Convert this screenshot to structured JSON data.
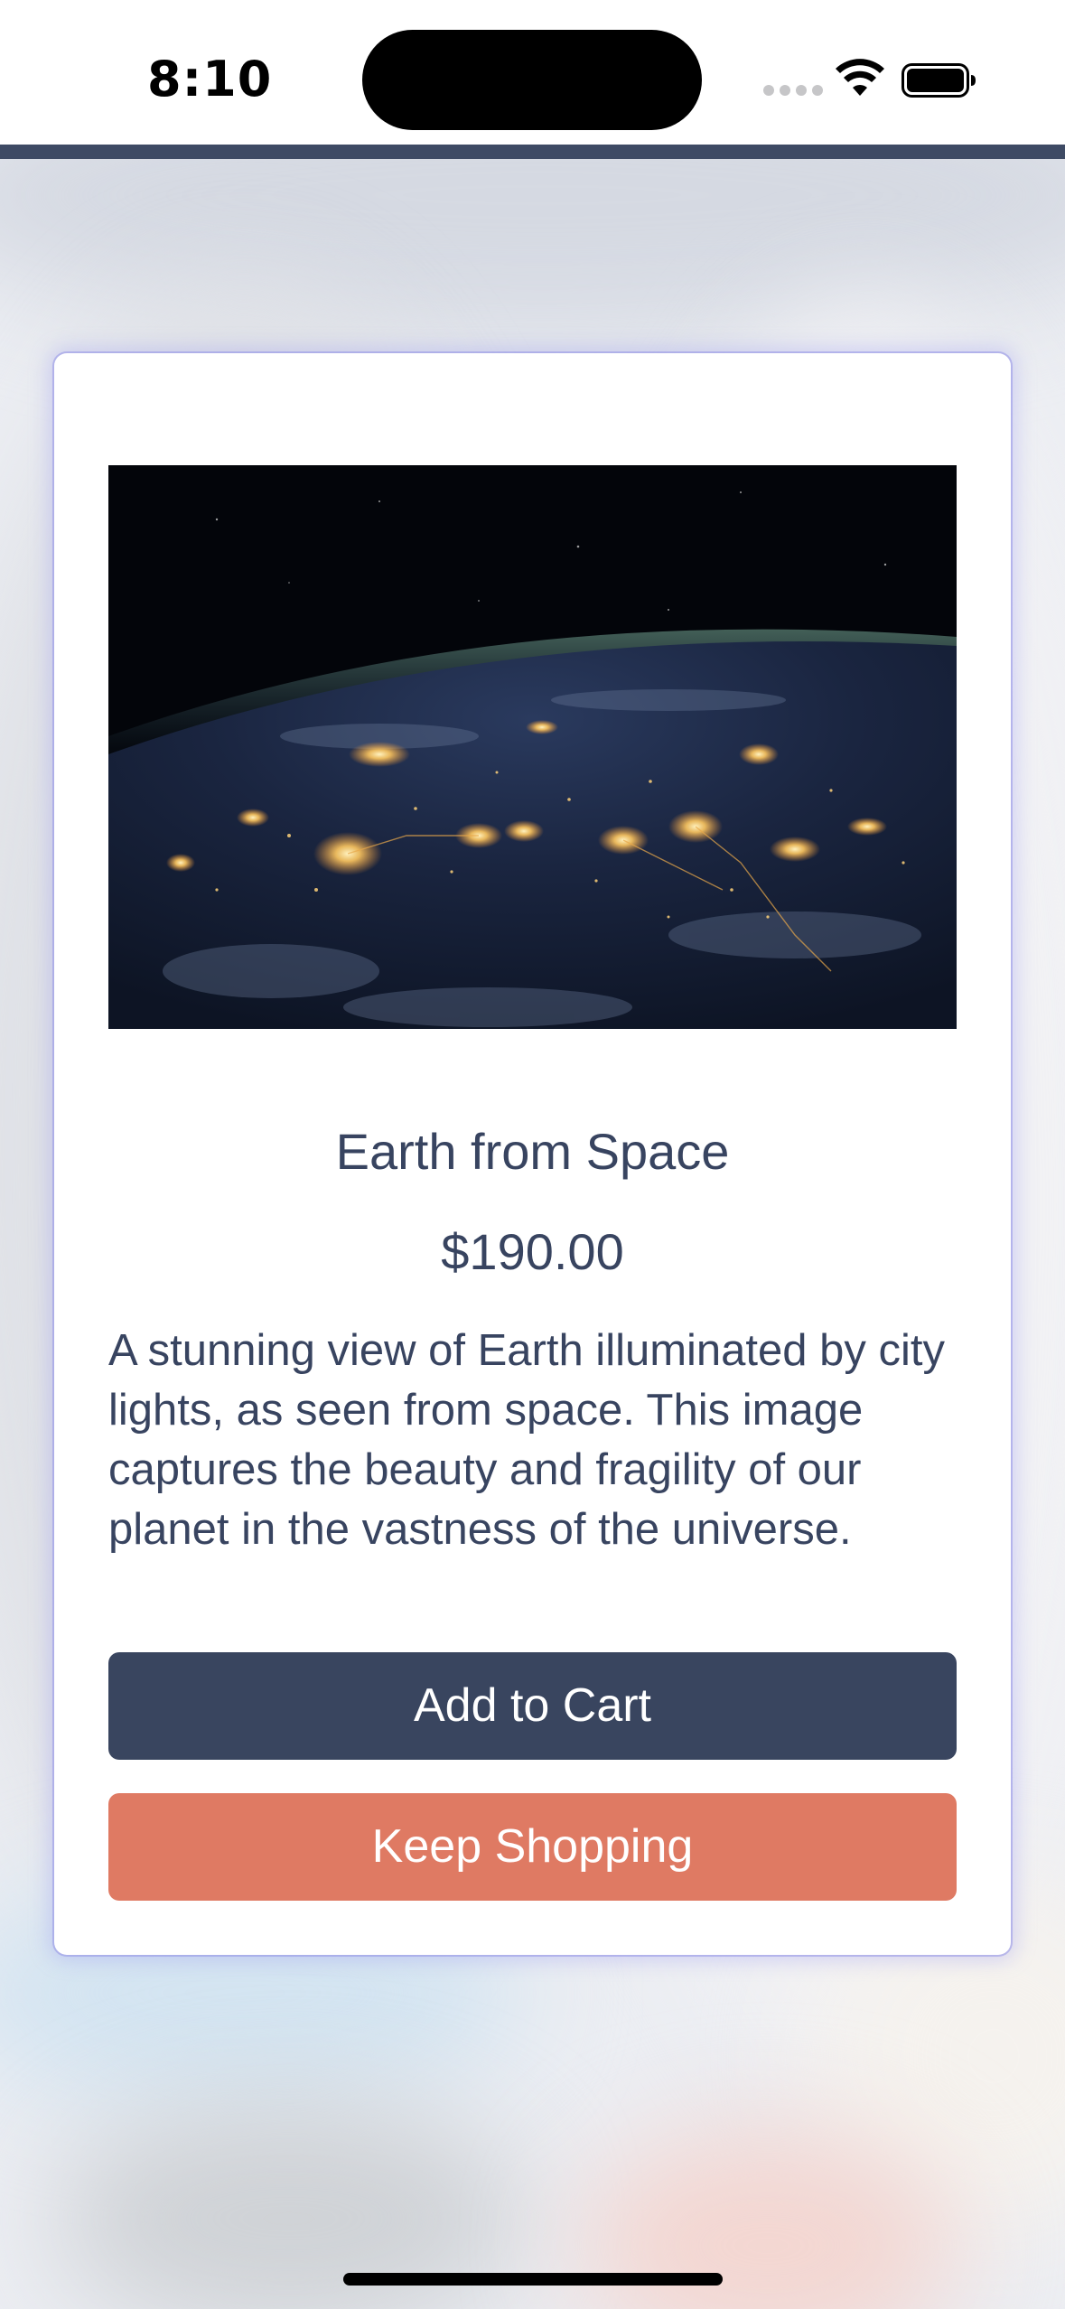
{
  "status_bar": {
    "time": "8:10"
  },
  "product": {
    "image_alt": "Earth from Space",
    "title": "Earth from Space",
    "price": "$190.00",
    "description": "A stunning view of Earth illuminated by city lights, as seen from space. This image captures the beauty and fragility of our planet in the vastness of the universe."
  },
  "actions": {
    "add_to_cart_label": "Add to Cart",
    "keep_shopping_label": "Keep Shopping"
  },
  "colors": {
    "text_primary": "#384460",
    "add_to_cart_bg": "#39455f",
    "keep_shopping_bg": "#df7a63",
    "header_strip": "#3e4a64"
  }
}
